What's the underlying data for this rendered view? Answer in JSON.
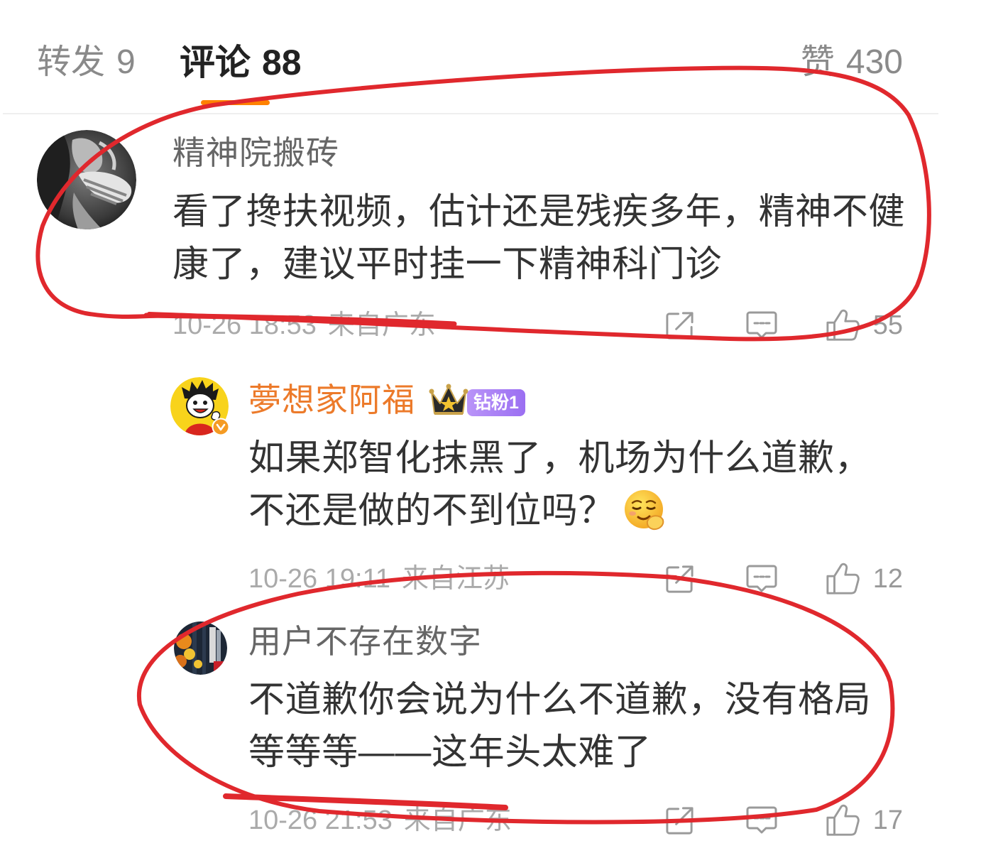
{
  "tabs": {
    "repost": {
      "label": "转发",
      "count": "9",
      "active": false
    },
    "comments": {
      "label": "评论",
      "count": "88",
      "active": true
    },
    "likes": {
      "label": "赞",
      "count": "430",
      "active": false
    }
  },
  "colors": {
    "accent": "#ff8200",
    "vip_username": "#ec7a2a",
    "badge_purple": "#9b6ff2",
    "annotation_red": "#e0282d",
    "meta_gray": "#aaaaaa"
  },
  "icons": {
    "share": "share-icon",
    "comment": "comment-icon",
    "like": "like-icon",
    "crown": "crown-icon",
    "verified": "verified-badge-icon",
    "emoji": "smirk-emoji"
  },
  "comments": [
    {
      "username": "精神院搬砖",
      "is_reply": false,
      "lines": [
        "看了搀扶视频，估计还是残疾多年，精神不健",
        "康了，建议平时挂一下精神科门诊"
      ],
      "time": "10-26 18:53",
      "location": "来自广东",
      "likes": "55"
    },
    {
      "username": "夢想家阿福",
      "is_reply": true,
      "verified": true,
      "fan_badge": "钻粉1",
      "lines": [
        "如果郑智化抹黑了，机场为什么道歉，",
        "不还是做的不到位吗？"
      ],
      "emoji": "smirk-emoji",
      "time": "10-26 19:11",
      "location": "来自江苏",
      "likes": "12"
    },
    {
      "username": "用户不存在数字",
      "is_reply": true,
      "lines": [
        "不道歉你会说为什么不道歉，没有格局",
        "等等等——这年头太难了"
      ],
      "time": "10-26 21:53",
      "location": "来自广东",
      "likes": "17"
    }
  ]
}
